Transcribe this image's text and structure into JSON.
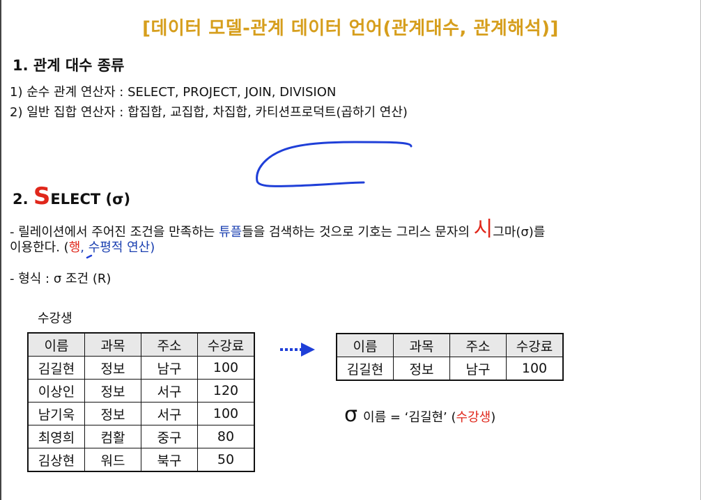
{
  "title": "[데이터 모델-관계 데이터 언어(관계대수, 관계해석)]",
  "section1": {
    "heading": "1. 관계 대수 종류",
    "items": [
      "1) 순수 관계 연산자 : SELECT, PROJECT, JOIN, DIVISION",
      "2) 일반 집합 연산자 : 합집합, 교집합, 차집합, 카티션프로덕트(곱하기 연산)"
    ]
  },
  "section2": {
    "heading_num": "2. ",
    "heading_S": "S",
    "heading_rest": "ELECT (σ)",
    "desc_a": "- 릴레이션에서 주어진 조건을 만족하는 ",
    "desc_tuple": "튜플",
    "desc_b": "들을 검색하는 것으로 기호는 그리스 문자의 ",
    "desc_si": "시",
    "desc_c": "그마(σ)를",
    "desc2_a": "이용한다. (",
    "desc2_red": "행",
    "desc2_blue": ", 수평적 연산)",
    "format": "- 형식 : σ 조건 (R)"
  },
  "table_caption": "수강생",
  "source_table": {
    "headers": [
      "이름",
      "과목",
      "주소",
      "수강료"
    ],
    "rows": [
      [
        "김길현",
        "정보",
        "남구",
        "100"
      ],
      [
        "이상인",
        "정보",
        "서구",
        "120"
      ],
      [
        "남기욱",
        "정보",
        "서구",
        "100"
      ],
      [
        "최영희",
        "컴활",
        "중구",
        "80"
      ],
      [
        "김상현",
        "워드",
        "북구",
        "50"
      ]
    ]
  },
  "result_table": {
    "headers": [
      "이름",
      "과목",
      "주소",
      "수강료"
    ],
    "rows": [
      [
        "김길현",
        "정보",
        "남구",
        "100"
      ]
    ]
  },
  "expression": {
    "sigma": "σ",
    "condition": "이름 = ‘김길현’ (",
    "relation": "수강생",
    "close": ")"
  },
  "colors": {
    "title": "#d69e1c",
    "accent_red": "#e0271b",
    "accent_blue": "#1a3fb0",
    "arrow": "#1f3fd8",
    "pen": "#1f3fd8"
  },
  "icons": [
    "dotted-arrow-icon",
    "pen-scribble",
    "pen-dot"
  ]
}
